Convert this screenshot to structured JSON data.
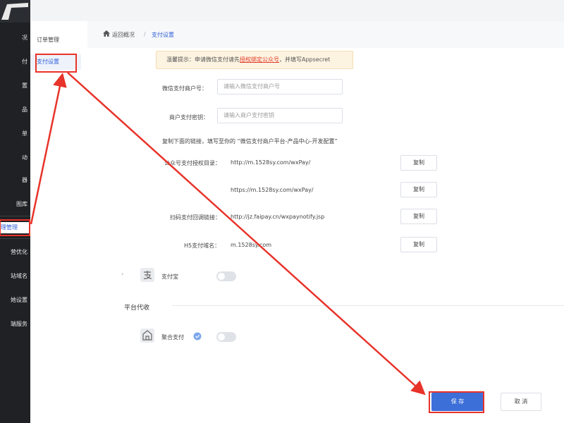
{
  "leftnav": {
    "items": [
      "况",
      "付",
      "置",
      "品",
      "单",
      "动",
      "器",
      "图库",
      "理管理",
      "营优化",
      "站域名",
      "她设置",
      "端服务"
    ]
  },
  "subnav": {
    "items": [
      "订单管理",
      "支付设置"
    ]
  },
  "breadcrumb": {
    "back": "返回概况",
    "sep": "/",
    "current": "支付设置"
  },
  "tip": {
    "prefix": "温馨提示：申请微信支付请先",
    "link": "授权绑定公众号",
    "suffix": "，并填写Appsecret"
  },
  "form": {
    "merchant_id_label": "微信支付商户号：",
    "merchant_id_placeholder": "请输入微信支付商户号",
    "merchant_key_label": "商户支付密钥：",
    "merchant_key_placeholder": "请输入商户支付密钥",
    "instruction": "复制下面的链接，填写至你的 “微信支付商户平台-产品中心-开发配置”",
    "auth_dir_label": "公众号支付授权目录：",
    "auth_dir_url_1": "http://m.1528sy.com/wxPay/",
    "auth_dir_url_2": "https://m.1528sy.com/wxPay/",
    "scan_callback_label": "扫码支付回调链接：",
    "scan_callback_url": "http://jz.faipay.cn/wxpaynotify.jsp",
    "h5_domain_label": "H5支付域名：",
    "h5_domain_url": "m.1528sy.com",
    "copy_label": "复制"
  },
  "alipay": {
    "label": "支付宝"
  },
  "platform": {
    "section_title": "平台代收",
    "aggregate_label": "聚合支付"
  },
  "actions": {
    "save": "保 存",
    "cancel": "取 消"
  },
  "colors": {
    "accent": "#3d6fd9",
    "annotation": "#e8332a"
  }
}
